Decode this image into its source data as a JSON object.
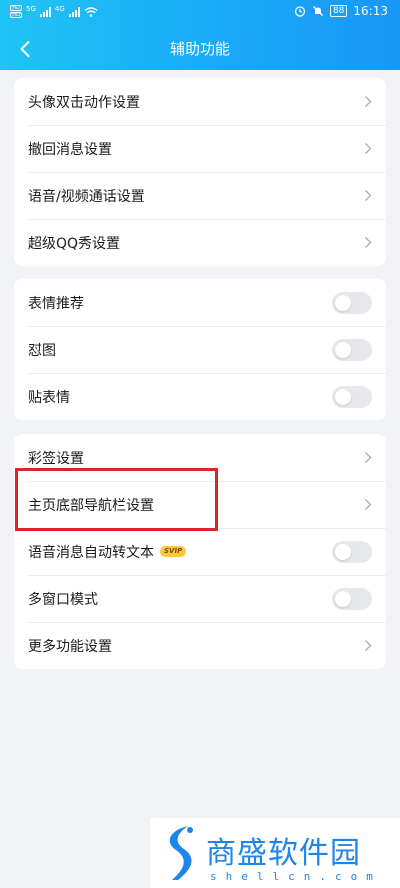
{
  "status_bar": {
    "left_badge_1": "HD",
    "left_badge_2": "HD",
    "signal_1": "5G",
    "signal_2": "4G",
    "icons": [
      "alarm-icon",
      "mute-icon"
    ],
    "battery": "88",
    "time": "16:13"
  },
  "header": {
    "title": "辅助功能",
    "background_colors": [
      "#1fc4f6",
      "#1a97f6"
    ]
  },
  "groups": [
    {
      "items": [
        {
          "label": "头像双击动作设置",
          "control": "chevron"
        },
        {
          "label": "撤回消息设置",
          "control": "chevron"
        },
        {
          "label": "语音/视频通话设置",
          "control": "chevron"
        },
        {
          "label": "超级QQ秀设置",
          "control": "chevron"
        }
      ]
    },
    {
      "items": [
        {
          "label": "表情推荐",
          "control": "toggle",
          "on": false
        },
        {
          "label": "怼图",
          "control": "toggle",
          "on": false
        },
        {
          "label": "贴表情",
          "control": "toggle",
          "on": false
        }
      ]
    },
    {
      "items": [
        {
          "label": "彩签设置",
          "control": "chevron"
        },
        {
          "label": "主页底部导航栏设置",
          "control": "chevron",
          "highlighted": true
        },
        {
          "label": "语音消息自动转文本",
          "control": "toggle",
          "on": false,
          "badge": "SVIP"
        },
        {
          "label": "多窗口模式",
          "control": "toggle",
          "on": false
        },
        {
          "label": "更多功能设置",
          "control": "chevron"
        }
      ]
    }
  ],
  "highlight_color": "#d7262c",
  "watermark": {
    "brand_cn": "商盛软件园",
    "brand_en": "shellcn.com",
    "color": "#1e86ea"
  }
}
